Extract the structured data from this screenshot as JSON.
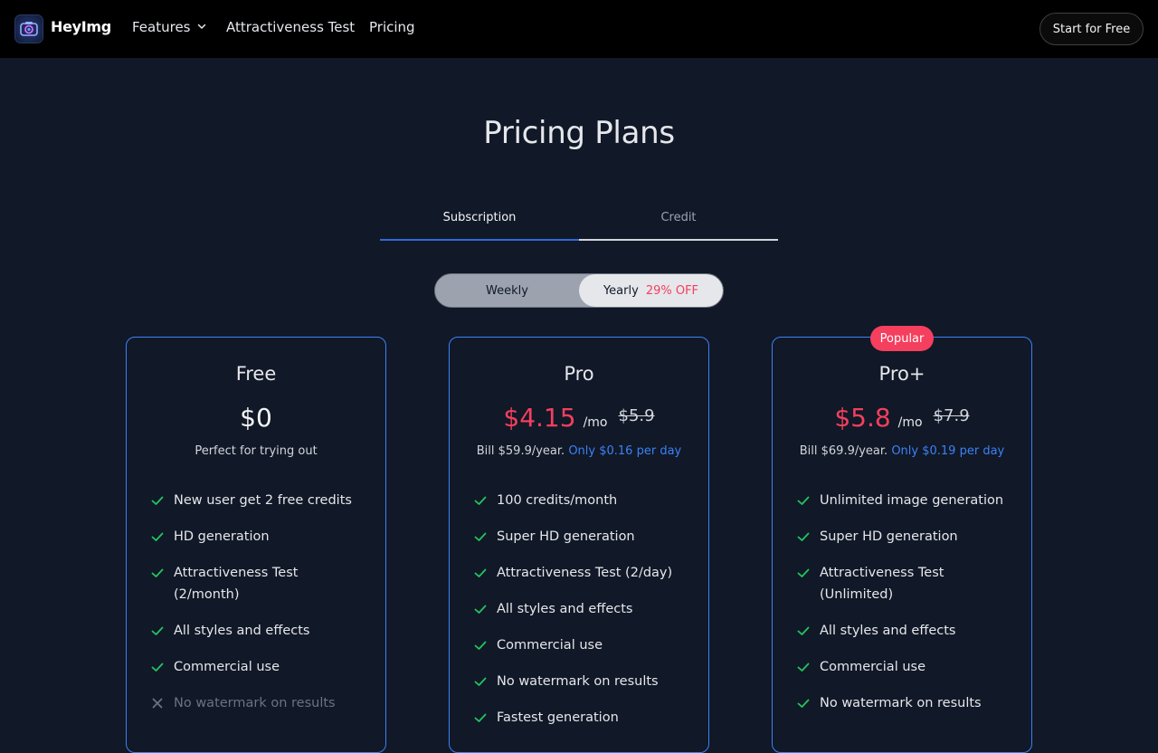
{
  "header": {
    "brand": "HeyImg",
    "nav": {
      "features": "Features",
      "attractiveness": "Attractiveness Test",
      "pricing": "Pricing"
    },
    "cta": "Start for Free"
  },
  "title": "Pricing Plans",
  "tabs": {
    "subscription": "Subscription",
    "credit": "Credit",
    "active": "Subscription"
  },
  "billing_toggle": {
    "weekly": "Weekly",
    "yearly": "Yearly",
    "discount": "29% OFF",
    "selected": "Yearly"
  },
  "popular_badge": "Popular",
  "colors": {
    "accent": "#3b82f6",
    "price": "#f43f5e",
    "check": "#22c55e",
    "background": "#111827"
  },
  "plans": [
    {
      "name": "Free",
      "price": "$0",
      "subtitle": "Perfect for trying out",
      "features": [
        {
          "text": "New user get 2 free credits",
          "included": true
        },
        {
          "text": "HD generation",
          "included": true
        },
        {
          "text": "Attractiveness Test (2/month)",
          "included": true
        },
        {
          "text": "All styles and effects",
          "included": true
        },
        {
          "text": "Commercial use",
          "included": true
        },
        {
          "text": "No watermark on results",
          "included": false
        }
      ]
    },
    {
      "name": "Pro",
      "price": "$4.15",
      "per": "/mo",
      "old_price": "$5.9",
      "bill": "Bill $59.9/year.",
      "per_day": "Only $0.16 per day",
      "features": [
        {
          "text": "100 credits/month",
          "included": true
        },
        {
          "text": "Super HD generation",
          "included": true
        },
        {
          "text": "Attractiveness Test (2/day)",
          "included": true
        },
        {
          "text": "All styles and effects",
          "included": true
        },
        {
          "text": "Commercial use",
          "included": true
        },
        {
          "text": "No watermark on results",
          "included": true
        },
        {
          "text": "Fastest generation",
          "included": true
        }
      ]
    },
    {
      "name": "Pro+",
      "price": "$5.8",
      "per": "/mo",
      "old_price": "$7.9",
      "bill": "Bill $69.9/year.",
      "per_day": "Only $0.19 per day",
      "features": [
        {
          "text": "Unlimited image generation",
          "included": true
        },
        {
          "text": "Super HD generation",
          "included": true
        },
        {
          "text": "Attractiveness Test (Unlimited)",
          "included": true
        },
        {
          "text": "All styles and effects",
          "included": true
        },
        {
          "text": "Commercial use",
          "included": true
        },
        {
          "text": "No watermark on results",
          "included": true
        }
      ]
    }
  ]
}
